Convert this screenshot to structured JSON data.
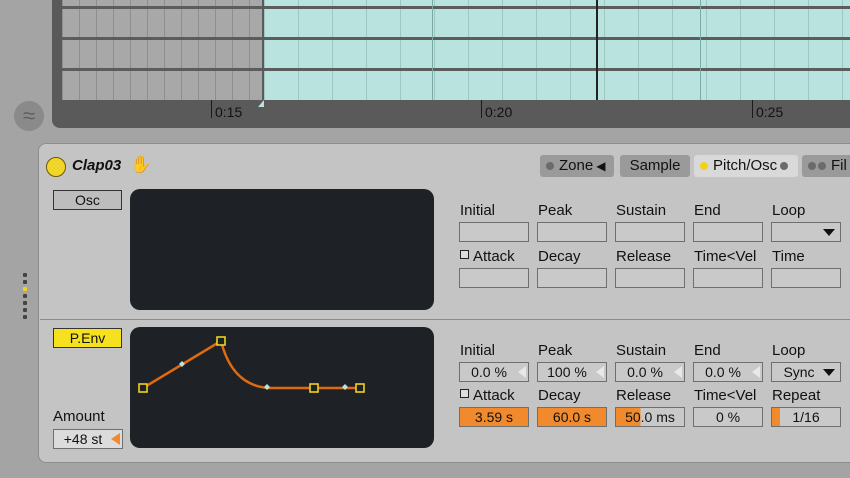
{
  "timeline": {
    "markers": [
      "0:15",
      "0:20",
      "0:25"
    ]
  },
  "device": {
    "name": "Clap03",
    "tabs": [
      {
        "label": "Zone",
        "led": false
      },
      {
        "label": "Sample",
        "led": false
      },
      {
        "label": "Pitch/Osc",
        "led": true
      },
      {
        "label": "Fil",
        "led": false
      }
    ]
  },
  "osc_section": {
    "button_label": "Osc",
    "row1_labels": [
      "Initial",
      "Peak",
      "Sustain",
      "End",
      "Loop"
    ],
    "row2_labels": [
      "Attack",
      "Decay",
      "Release",
      "Time<Vel",
      "Time"
    ],
    "row1_values": [
      "",
      "",
      "",
      "",
      ""
    ],
    "row2_values": [
      "",
      "",
      "",
      "",
      ""
    ]
  },
  "penv_section": {
    "button_label": "P.Env",
    "amount_label": "Amount",
    "amount_value": "+48 st",
    "row1_labels": [
      "Initial",
      "Peak",
      "Sustain",
      "End",
      "Loop"
    ],
    "row1_values": [
      "0.0 %",
      "100 %",
      "0.0 %",
      "0.0 %",
      "Sync"
    ],
    "row2_labels": [
      "Attack",
      "Decay",
      "Release",
      "Time<Vel",
      "Repeat"
    ],
    "row2_values": [
      "3.59 s",
      "60.0 s",
      "50.0 ms",
      "0 %",
      "1/16"
    ]
  },
  "colors": {
    "accent_orange": "#f08a2d",
    "teal_clip": "#b8e3df",
    "led_yellow": "#f0d21d",
    "display_bg": "#1e2226",
    "envelope_line": "#e06a10"
  }
}
